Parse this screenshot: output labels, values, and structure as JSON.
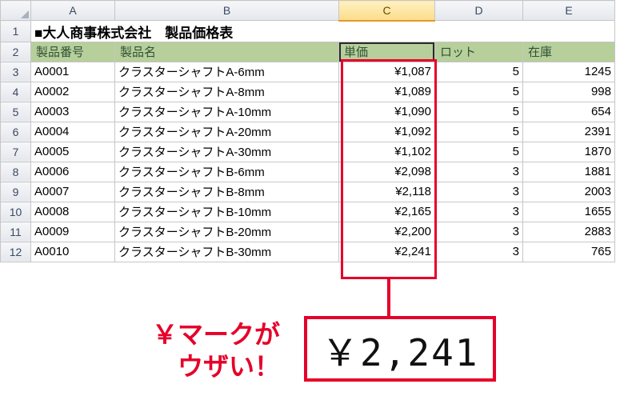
{
  "columns": [
    "A",
    "B",
    "C",
    "D",
    "E"
  ],
  "selected_column": "C",
  "title": "■大人商事株式会社　製品価格表",
  "headers": {
    "a": "製品番号",
    "b": "製品名",
    "c": "単価",
    "d": "ロット",
    "e": "在庫"
  },
  "rows": [
    {
      "n": "3",
      "a": "A0001",
      "b": "クラスターシャフトA-6mm",
      "c": "¥1,087",
      "d": "5",
      "e": "1245"
    },
    {
      "n": "4",
      "a": "A0002",
      "b": "クラスターシャフトA-8mm",
      "c": "¥1,089",
      "d": "5",
      "e": "998"
    },
    {
      "n": "5",
      "a": "A0003",
      "b": "クラスターシャフトA-10mm",
      "c": "¥1,090",
      "d": "5",
      "e": "654"
    },
    {
      "n": "6",
      "a": "A0004",
      "b": "クラスターシャフトA-20mm",
      "c": "¥1,092",
      "d": "5",
      "e": "2391"
    },
    {
      "n": "7",
      "a": "A0005",
      "b": "クラスターシャフトA-30mm",
      "c": "¥1,102",
      "d": "5",
      "e": "1870"
    },
    {
      "n": "8",
      "a": "A0006",
      "b": "クラスターシャフトB-6mm",
      "c": "¥2,098",
      "d": "3",
      "e": "1881"
    },
    {
      "n": "9",
      "a": "A0007",
      "b": "クラスターシャフトB-8mm",
      "c": "¥2,118",
      "d": "3",
      "e": "2003"
    },
    {
      "n": "10",
      "a": "A0008",
      "b": "クラスターシャフトB-10mm",
      "c": "¥2,165",
      "d": "3",
      "e": "1655"
    },
    {
      "n": "11",
      "a": "A0009",
      "b": "クラスターシャフトB-20mm",
      "c": "¥2,200",
      "d": "3",
      "e": "2883"
    },
    {
      "n": "12",
      "a": "A0010",
      "b": "クラスターシャフトB-30mm",
      "c": "¥2,241",
      "d": "3",
      "e": "765"
    }
  ],
  "annotation": {
    "callout_line1": "￥マークが",
    "callout_line2": "ウザい！",
    "big_price": "￥2,241"
  },
  "chart_data": {
    "type": "table",
    "title": "■大人商事株式会社　製品価格表",
    "columns": [
      "製品番号",
      "製品名",
      "単価",
      "ロット",
      "在庫"
    ],
    "rows": [
      [
        "A0001",
        "クラスターシャフトA-6mm",
        1087,
        5,
        1245
      ],
      [
        "A0002",
        "クラスターシャフトA-8mm",
        1089,
        5,
        998
      ],
      [
        "A0003",
        "クラスターシャフトA-10mm",
        1090,
        5,
        654
      ],
      [
        "A0004",
        "クラスターシャフトA-20mm",
        1092,
        5,
        2391
      ],
      [
        "A0005",
        "クラスターシャフトA-30mm",
        1102,
        5,
        1870
      ],
      [
        "A0006",
        "クラスターシャフトB-6mm",
        2098,
        3,
        1881
      ],
      [
        "A0007",
        "クラスターシャフトB-8mm",
        2118,
        3,
        2003
      ],
      [
        "A0008",
        "クラスターシャフトB-10mm",
        2165,
        3,
        1655
      ],
      [
        "A0009",
        "クラスターシャフトB-20mm",
        2200,
        3,
        2883
      ],
      [
        "A0010",
        "クラスターシャフトB-30mm",
        2241,
        3,
        765
      ]
    ]
  }
}
